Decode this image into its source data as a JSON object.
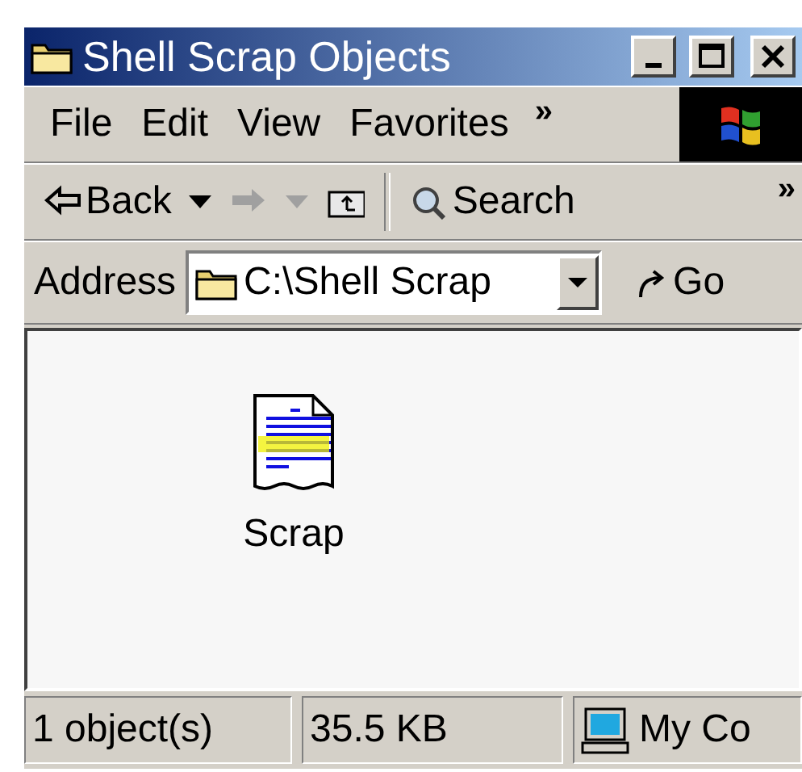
{
  "window": {
    "title": "Shell Scrap Objects"
  },
  "menu": {
    "items": [
      {
        "label": "File"
      },
      {
        "label": "Edit"
      },
      {
        "label": "View"
      },
      {
        "label": "Favorites"
      }
    ],
    "overflow": "»"
  },
  "toolbar": {
    "buttons": [
      {
        "kind": "back",
        "label": "Back",
        "disabled": false
      },
      {
        "kind": "dropdown",
        "disabled": false
      },
      {
        "kind": "forward",
        "disabled": true
      },
      {
        "kind": "dropdown",
        "disabled": true
      },
      {
        "kind": "up",
        "disabled": false
      },
      {
        "kind": "separator"
      },
      {
        "kind": "search",
        "label": "Search",
        "disabled": false
      }
    ],
    "overflow": "»"
  },
  "address": {
    "label": "Address",
    "value": "C:\\Shell Scrap",
    "go": "Go"
  },
  "items": [
    {
      "label": "Scrap",
      "selected": false
    }
  ],
  "status_bar": [
    {
      "kind": "text",
      "text": "1 object(s)"
    },
    {
      "kind": "text",
      "text": "35.5 KB"
    },
    {
      "kind": "zone",
      "text": "My Co"
    }
  ]
}
